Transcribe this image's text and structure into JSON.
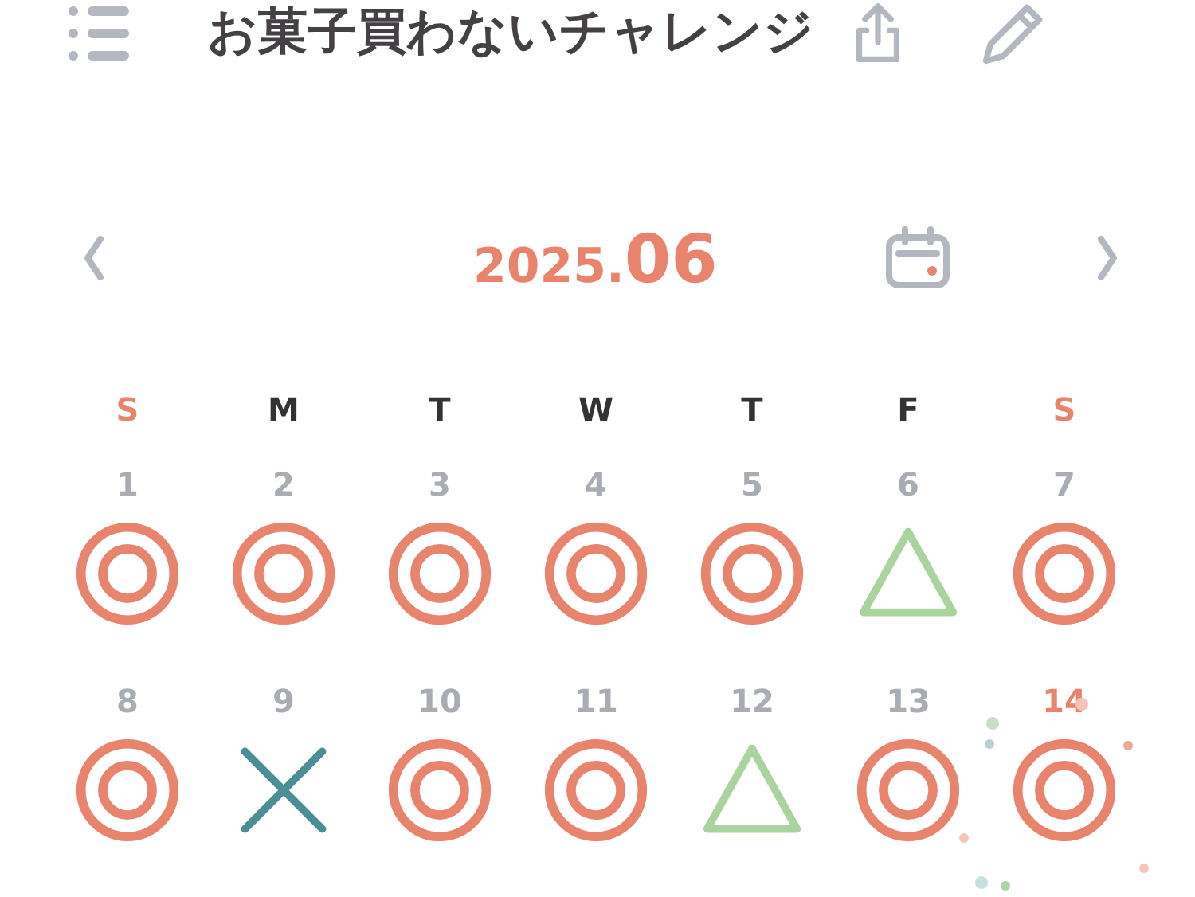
{
  "header": {
    "title": "お菓子買わないチャレンジ"
  },
  "month": {
    "year": "2025.",
    "month": "06"
  },
  "weekdays": [
    {
      "label": "S",
      "color": "#e8836c"
    },
    {
      "label": "M",
      "color": "#333333"
    },
    {
      "label": "T",
      "color": "#333333"
    },
    {
      "label": "W",
      "color": "#333333"
    },
    {
      "label": "T",
      "color": "#333333"
    },
    {
      "label": "F",
      "color": "#333333"
    },
    {
      "label": "S",
      "color": "#e8836c"
    }
  ],
  "weeks": [
    [
      {
        "day": "1",
        "kind": "circle",
        "selected": false
      },
      {
        "day": "2",
        "kind": "circle",
        "selected": false
      },
      {
        "day": "3",
        "kind": "circle",
        "selected": false
      },
      {
        "day": "4",
        "kind": "circle",
        "selected": false
      },
      {
        "day": "5",
        "kind": "circle",
        "selected": false
      },
      {
        "day": "6",
        "kind": "triangle",
        "selected": false
      },
      {
        "day": "7",
        "kind": "circle",
        "selected": false
      }
    ],
    [
      {
        "day": "8",
        "kind": "circle",
        "selected": false
      },
      {
        "day": "9",
        "kind": "cross",
        "selected": false
      },
      {
        "day": "10",
        "kind": "circle",
        "selected": false
      },
      {
        "day": "11",
        "kind": "circle",
        "selected": false
      },
      {
        "day": "12",
        "kind": "triangle",
        "selected": false
      },
      {
        "day": "13",
        "kind": "circle",
        "selected": false
      },
      {
        "day": "14",
        "kind": "circle",
        "selected": true
      }
    ]
  ]
}
